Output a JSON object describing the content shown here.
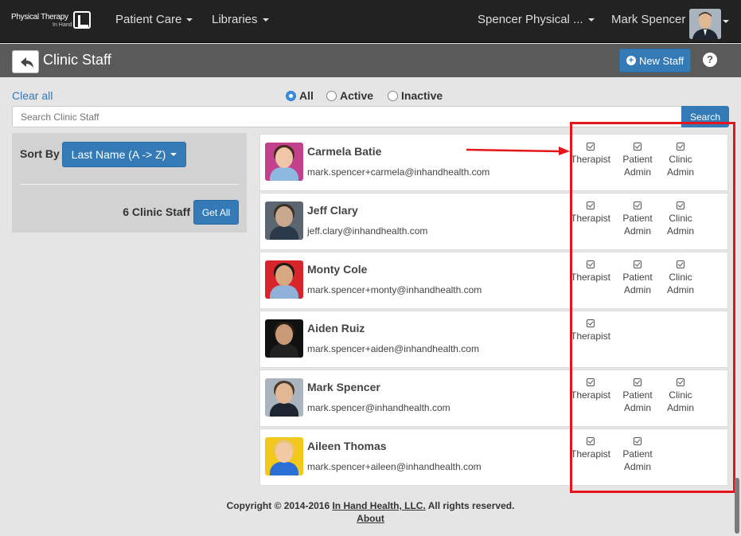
{
  "nav": {
    "brand_line1": "Physical Therapy",
    "brand_line2": "In Hand",
    "menu": [
      {
        "label": "Patient Care"
      },
      {
        "label": "Libraries"
      }
    ],
    "clinic": "Spencer Physical ...",
    "user": "Mark Spencer"
  },
  "titlebar": {
    "title": "Clinic Staff",
    "new_staff_label": "New Staff",
    "help_glyph": "?"
  },
  "filters": {
    "clear_all": "Clear all",
    "options": [
      {
        "label": "All",
        "selected": true
      },
      {
        "label": "Active",
        "selected": false
      },
      {
        "label": "Inactive",
        "selected": false
      }
    ],
    "search_placeholder": "Search Clinic Staff",
    "search_button": "Search"
  },
  "sidebar": {
    "sort_label": "Sort By",
    "sort_value": "Last Name (A -> Z)",
    "count_label": "6 Clinic Staff",
    "get_all": "Get All"
  },
  "role_labels": {
    "therapist": "Therapist",
    "patient_admin": [
      "Patient",
      "Admin"
    ],
    "clinic_admin": [
      "Clinic",
      "Admin"
    ]
  },
  "staff": [
    {
      "name": "Carmela Batie",
      "email": "mark.spencer+carmela@inhandhealth.com",
      "roles": [
        "therapist",
        "patient_admin",
        "clinic_admin"
      ],
      "photo_bg": "#c2408c",
      "skin": "#f1c6a8",
      "hair": "#4a2c1d",
      "shirt": "#8fb8e0"
    },
    {
      "name": "Jeff Clary",
      "email": "jeff.clary@inhandhealth.com",
      "roles": [
        "therapist",
        "patient_admin",
        "clinic_admin"
      ],
      "photo_bg": "#5b6670",
      "skin": "#c9a88e",
      "hair": "#3b3028",
      "shirt": "#2b3a4a"
    },
    {
      "name": "Monty Cole",
      "email": "mark.spencer+monty@inhandhealth.com",
      "roles": [
        "therapist",
        "patient_admin",
        "clinic_admin"
      ],
      "photo_bg": "#d8252b",
      "skin": "#d8a882",
      "hair": "#1f1a16",
      "shirt": "#8fb0d8"
    },
    {
      "name": "Aiden Ruiz",
      "email": "mark.spencer+aiden@inhandhealth.com",
      "roles": [
        "therapist"
      ],
      "photo_bg": "#111111",
      "skin": "#c99a78",
      "hair": "#2b1d14",
      "shirt": "#222222"
    },
    {
      "name": "Mark Spencer",
      "email": "mark.spencer@inhandhealth.com",
      "roles": [
        "therapist",
        "patient_admin",
        "clinic_admin"
      ],
      "photo_bg": "#aab4be",
      "skin": "#e2b894",
      "hair": "#4a3a2c",
      "shirt": "#1d2530"
    },
    {
      "name": "Aileen Thomas",
      "email": "mark.spencer+aileen@inhandhealth.com",
      "roles": [
        "therapist",
        "patient_admin"
      ],
      "photo_bg": "#f2c81a",
      "skin": "#f3c9a4",
      "hair": "#e8c56a",
      "shirt": "#2a6fd6"
    }
  ],
  "footer": {
    "copyright_prefix": "Copyright © 2014-2016 ",
    "company": "In Hand Health, LLC.",
    "copyright_suffix": " All rights reserved.",
    "about": "About"
  },
  "colors": {
    "primary": "#337ab7",
    "navbar": "#222222",
    "titlebar": "#5a5a5a",
    "annotation": "#e4151b"
  }
}
